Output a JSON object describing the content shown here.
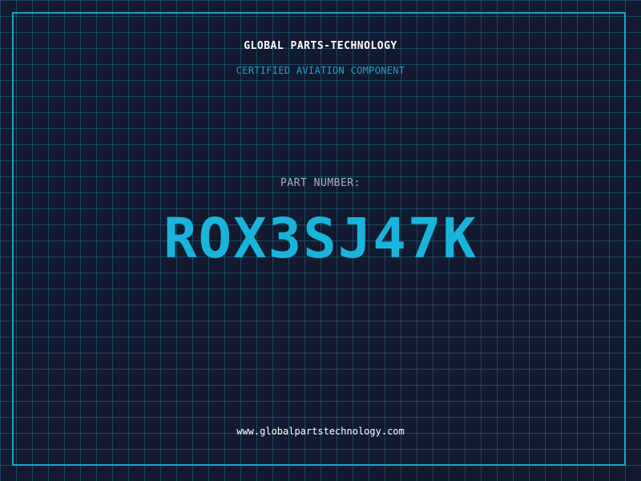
{
  "header": {
    "company_name": "GLOBAL PARTS-TECHNOLOGY",
    "tagline": "CERTIFIED AVIATION COMPONENT"
  },
  "part": {
    "label": "PART NUMBER:",
    "number": "ROX3SJ47K"
  },
  "footer": {
    "website": "www.globalpartstechnology.com"
  },
  "colors": {
    "background": "#111a2e",
    "grid": "#266e8c",
    "accent": "#1ba3c9",
    "part_number": "#19b4dc",
    "label": "#a7b1c2",
    "text": "#ffffff"
  }
}
